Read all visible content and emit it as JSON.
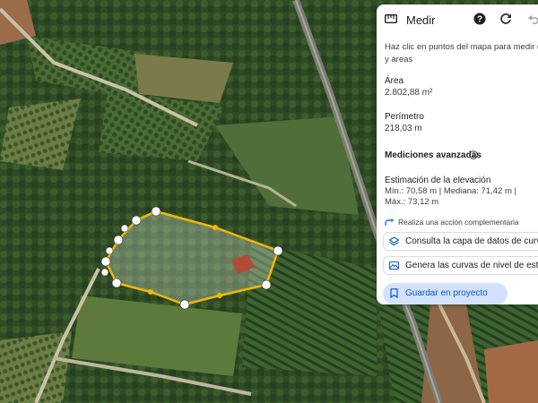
{
  "panel": {
    "title": "Medir",
    "hint": "Haz clic en puntos del mapa para medir dist\ny áreas",
    "area_label": "Área",
    "area_value": "2.802,88 m²",
    "perimeter_label": "Perímetro",
    "perimeter_value": "218,03 m",
    "advanced_title": "Mediciones avanzadas",
    "elevation_label": "Estimación de la elevación",
    "elevation_value": "Mín.: 70,58 m | Mediana: 71,42 m | Máx.: 73,12 m",
    "action_hint": "Realiza una acción complementaria",
    "chip1_label": "Consulta la capa de datos de curvas",
    "chip2_label": "Genera las curvas de nivel de este te",
    "save_label": "Guardar en proyecto"
  },
  "icons": {
    "header": [
      "ruler-icon",
      "help-icon",
      "reset-icon",
      "undo-icon"
    ],
    "info": "info-icon",
    "action": "action-arrow-icon",
    "chip1": "layers-icon",
    "chip2": "terrain-icon",
    "save": "bookmark-icon"
  },
  "colors": {
    "polygon_outline": "#f2b705",
    "polygon_fill": "rgba(255,255,255,0.22)",
    "vertex": "#ffffff",
    "save_bg": "#d3e3fd",
    "save_text": "#0b57d0"
  }
}
